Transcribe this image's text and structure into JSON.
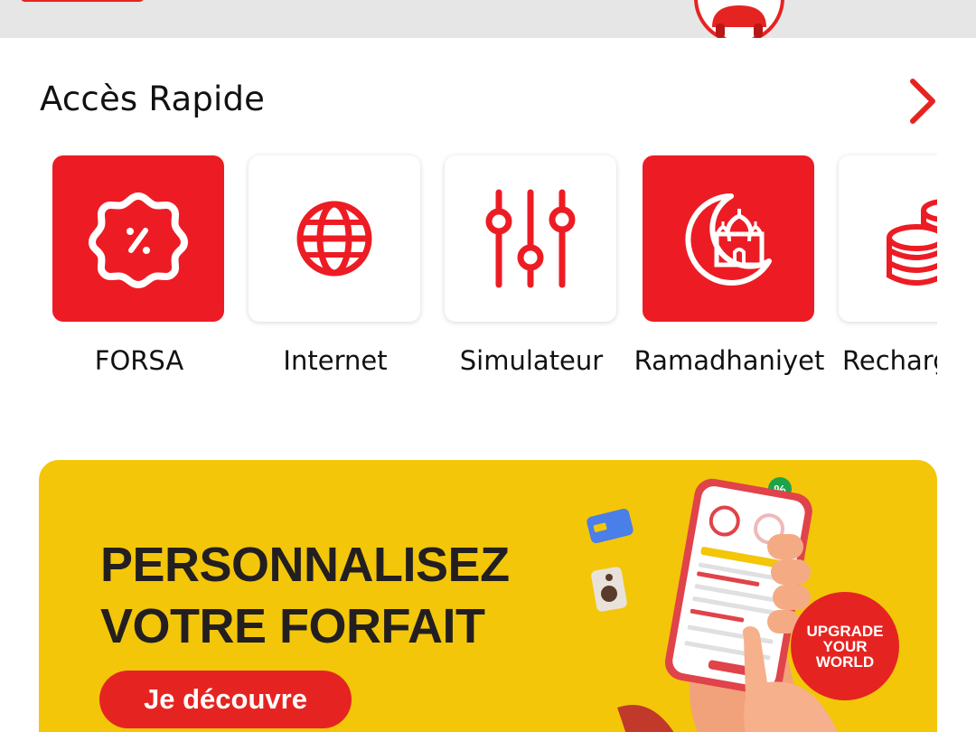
{
  "quick_access": {
    "title": "Accès Rapide",
    "items": [
      {
        "label": "FORSA",
        "icon": "discount-badge-icon",
        "style": "red"
      },
      {
        "label": "Internet",
        "icon": "globe-icon",
        "style": "white"
      },
      {
        "label": "Simulateur",
        "icon": "sliders-icon",
        "style": "white"
      },
      {
        "label": "Ramadhaniyet",
        "icon": "crescent-mosque-icon",
        "style": "red"
      },
      {
        "label": "Recharge",
        "icon": "coins-icon",
        "style": "white"
      }
    ]
  },
  "promo": {
    "headline_line1": "PERSONNALISEZ",
    "headline_line2": "VOTRE FORFAIT",
    "cta_label": "Je découvre",
    "badge_line1": "UPGRADE",
    "badge_line2": "YOUR",
    "badge_line3": "WORLD"
  },
  "colors": {
    "brand_red": "#ed1c24",
    "banner_yellow": "#f3c609",
    "text_dark": "#231f20",
    "top_strip": "#e6e6e6"
  }
}
